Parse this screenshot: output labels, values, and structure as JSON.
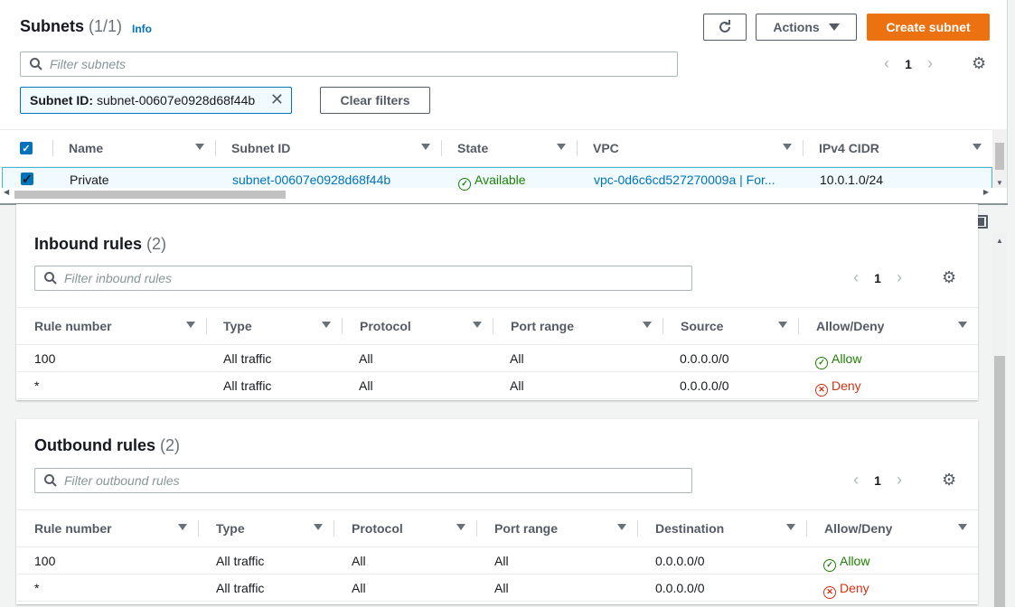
{
  "subnets": {
    "title": "Subnets",
    "count": "(1/1)",
    "info": "Info",
    "actions_label": "Actions",
    "create_label": "Create subnet",
    "search_placeholder": "Filter subnets",
    "page": "1",
    "filter_token": {
      "key": "Subnet ID:",
      "value": "subnet-00607e0928d68f44b"
    },
    "clear_filters": "Clear filters",
    "columns": [
      "Name",
      "Subnet ID",
      "State",
      "VPC",
      "IPv4 CIDR"
    ],
    "row": {
      "selected": true,
      "name": "Private",
      "subnet_id": "subnet-00607e0928d68f44b",
      "state": "Available",
      "vpc": "vpc-0d6c6cd527270009a | For...",
      "cidr": "10.0.1.0/24"
    }
  },
  "inbound": {
    "title": "Inbound rules",
    "count": "(2)",
    "search_placeholder": "Filter inbound rules",
    "page": "1",
    "columns": [
      "Rule number",
      "Type",
      "Protocol",
      "Port range",
      "Source",
      "Allow/Deny"
    ],
    "rows": [
      {
        "rule": "100",
        "type": "All traffic",
        "protocol": "All",
        "port": "All",
        "source": "0.0.0.0/0",
        "action": "Allow"
      },
      {
        "rule": "*",
        "type": "All traffic",
        "protocol": "All",
        "port": "All",
        "source": "0.0.0.0/0",
        "action": "Deny"
      }
    ]
  },
  "outbound": {
    "title": "Outbound rules",
    "count": "(2)",
    "search_placeholder": "Filter outbound rules",
    "page": "1",
    "columns": [
      "Rule number",
      "Type",
      "Protocol",
      "Port range",
      "Destination",
      "Allow/Deny"
    ],
    "rows": [
      {
        "rule": "100",
        "type": "All traffic",
        "protocol": "All",
        "port": "All",
        "destination": "0.0.0.0/0",
        "action": "Allow"
      },
      {
        "rule": "*",
        "type": "All traffic",
        "protocol": "All",
        "port": "All",
        "destination": "0.0.0.0/0",
        "action": "Deny"
      }
    ]
  },
  "colors": {
    "accent": "#ec7211",
    "link": "#0073bb",
    "success": "#1d8102",
    "error": "#d13212"
  }
}
